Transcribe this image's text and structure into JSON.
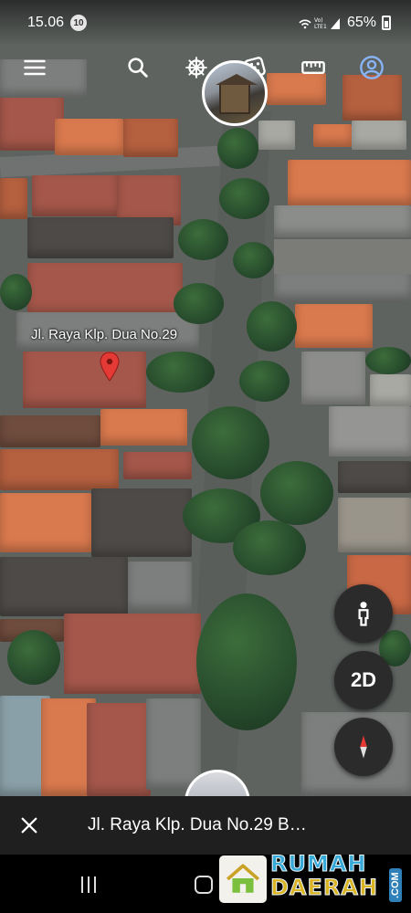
{
  "status_bar": {
    "time": "15.06",
    "notification_count": "10",
    "network_label": "Vo) LTE1",
    "battery": "65%"
  },
  "toolbar": {
    "menu_icon": "hamburger-menu-icon",
    "search_icon": "search-icon",
    "voyager_icon": "ship-wheel-icon",
    "random_icon": "dice-icon",
    "measure_icon": "ruler-icon",
    "account_icon": "account-circle-icon"
  },
  "map": {
    "place_label": "Jl. Raya Klp. Dua No.29",
    "pin_color": "#e53935"
  },
  "controls": {
    "pegman_icon": "pegman-icon",
    "view_mode": "2D",
    "compass_icon": "compass-icon"
  },
  "info_bar": {
    "title": "Jl. Raya Klp. Dua No.29  B…",
    "close_icon": "close-icon"
  },
  "watermark": {
    "line1": "RUMAH",
    "line2": "DAERAH",
    "suffix": ".COM",
    "color_primary": "#38a9d6",
    "color_secondary": "#d9b323"
  }
}
